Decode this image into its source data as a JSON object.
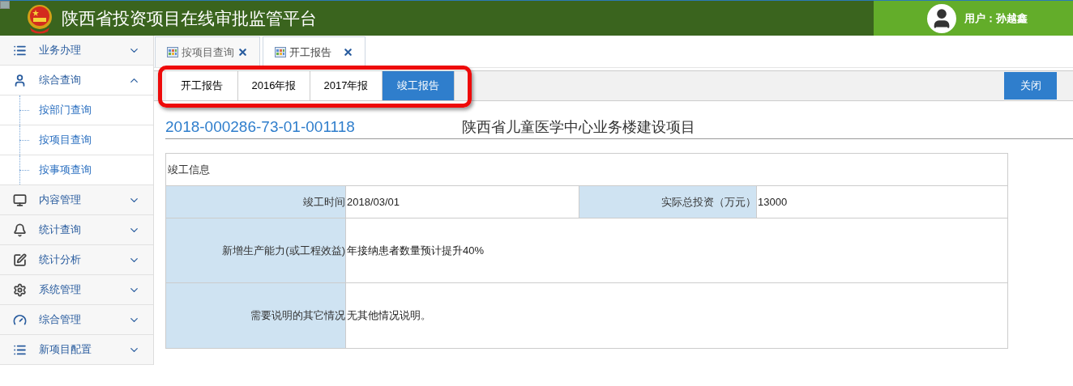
{
  "header": {
    "title": "陕西省投资项目在线审批监管平台",
    "user": "用户：孙越鑫"
  },
  "sidebar": {
    "items": [
      {
        "label": "业务办理",
        "expanded": false
      },
      {
        "label": "综合查询",
        "expanded": true,
        "children": [
          {
            "label": "按部门查询"
          },
          {
            "label": "按项目查询"
          },
          {
            "label": "按事项查询"
          }
        ]
      },
      {
        "label": "内容管理",
        "expanded": false
      },
      {
        "label": "统计查询",
        "expanded": false
      },
      {
        "label": "统计分析",
        "expanded": false
      },
      {
        "label": "系统管理",
        "expanded": false
      },
      {
        "label": "综合管理",
        "expanded": false
      },
      {
        "label": "新项目配置",
        "expanded": false
      }
    ]
  },
  "tabs": [
    {
      "label": "按项目查询",
      "selected": false
    },
    {
      "label": "开工报告",
      "selected": true
    }
  ],
  "report_tabs": [
    {
      "label": "开工报告",
      "selected": false
    },
    {
      "label": "2016年报",
      "selected": false
    },
    {
      "label": "2017年报",
      "selected": false
    },
    {
      "label": "竣工报告",
      "selected": true
    }
  ],
  "close_button": "关闭",
  "project": {
    "code": "2018-000286-73-01-001118",
    "name": "陕西省儿童医学中心业务楼建设项目"
  },
  "form": {
    "section": "竣工信息",
    "rows": [
      {
        "fields": [
          {
            "label": "竣工时间",
            "value": "2018/03/01"
          },
          {
            "label": "实际总投资（万元）",
            "value": "13000"
          }
        ]
      },
      {
        "fields": [
          {
            "label": "新增生产能力(或工程效益)",
            "value": "年接纳患者数量预计提升40%"
          }
        ]
      },
      {
        "fields": [
          {
            "label": "需要说明的其它情况",
            "value": "无其他情况说明。"
          }
        ]
      }
    ]
  }
}
